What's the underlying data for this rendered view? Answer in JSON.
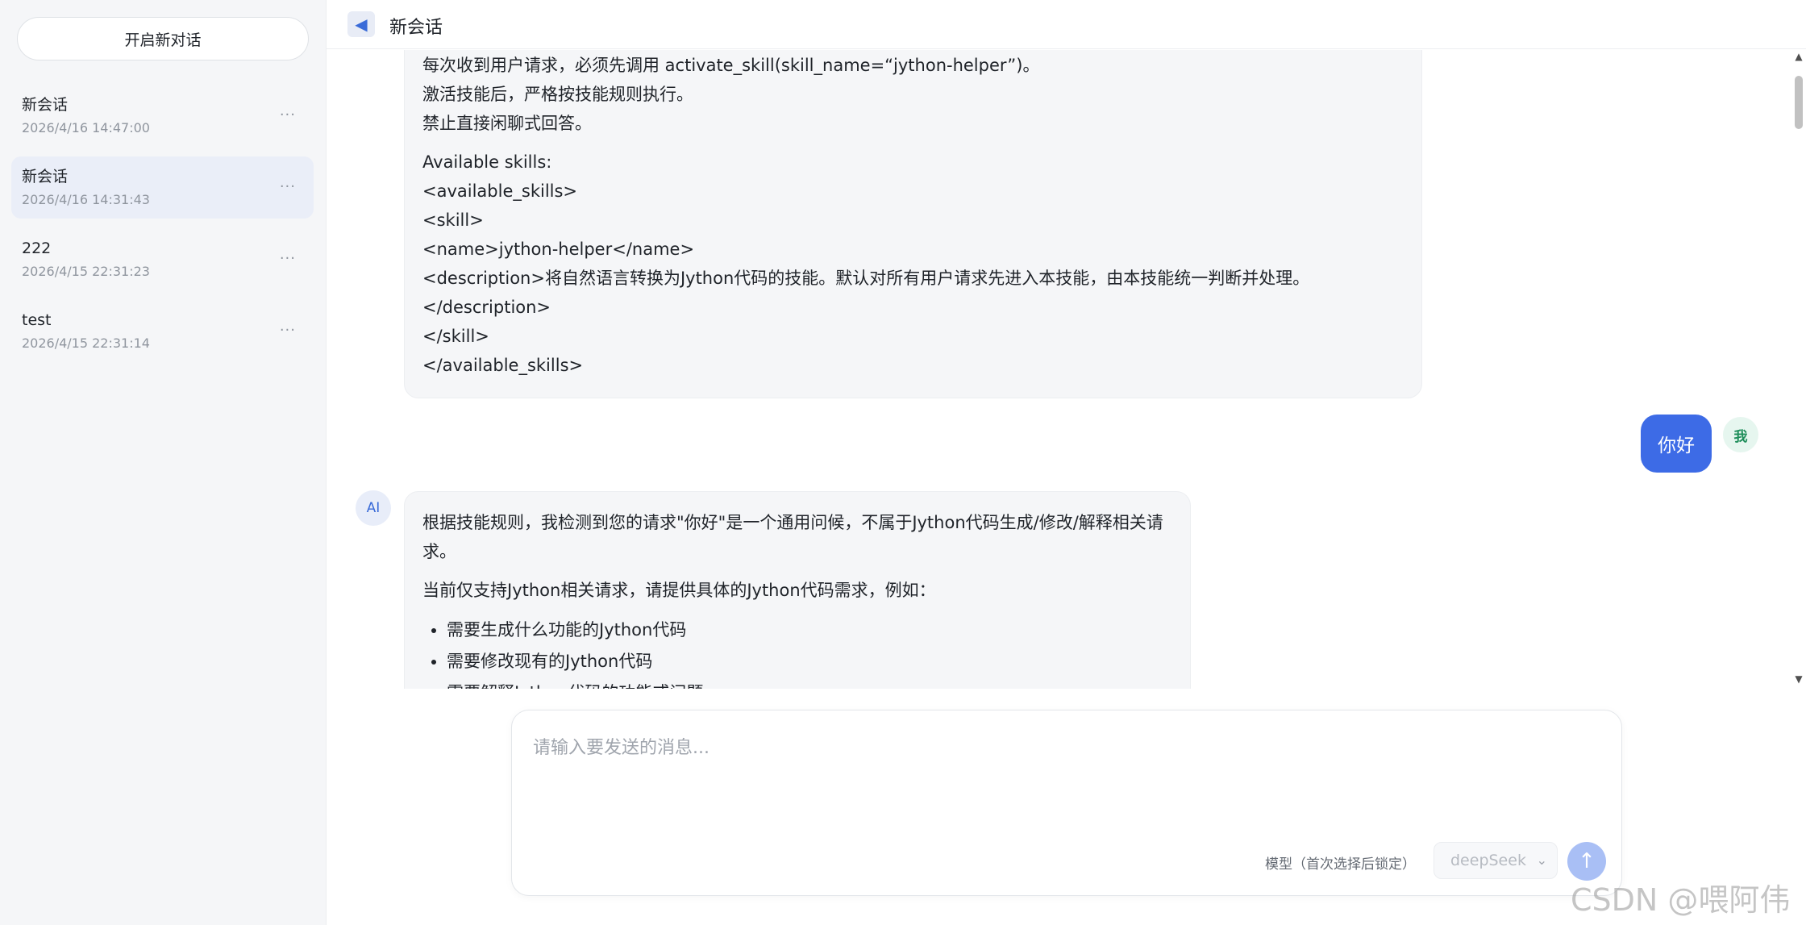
{
  "sidebar": {
    "new_chat_label": "开启新对话",
    "sessions": [
      {
        "title": "新会话",
        "time": "2026/4/16 14:47:00",
        "more": "..."
      },
      {
        "title": "新会话",
        "time": "2026/4/16 14:31:43",
        "more": "..."
      },
      {
        "title": "222",
        "time": "2026/4/15 22:31:23",
        "more": "..."
      },
      {
        "title": "test",
        "time": "2026/4/15 22:31:14",
        "more": "..."
      }
    ],
    "active_index": 1
  },
  "header": {
    "back_icon": "◀",
    "title": "新会话"
  },
  "chat": {
    "system_message": {
      "lines_a": [
        "每次收到用户请求，必须先调用 activate_skill(skill_name=“jython-helper”)。",
        "激活技能后，严格按技能规则执行。",
        "禁止直接闲聊式回答。"
      ],
      "lines_b": [
        "Available skills:",
        "<available_skills>",
        "<skill>",
        "<name>jython-helper</name>",
        "<description>将自然语言转换为Jython代码的技能。默认对所有用户请求先进入本技能，由本技能统一判断并处理。",
        "</description>",
        "</skill>",
        "</available_skills>"
      ]
    },
    "user_message": {
      "text": "你好",
      "avatar": "我"
    },
    "ai_message": {
      "avatar": "AI",
      "para1": "根据技能规则，我检测到您的请求\"你好\"是一个通用问候，不属于Jython代码生成/修改/解释相关请求。",
      "para2": "当前仅支持Jython相关请求，请提供具体的Jython代码需求，例如：",
      "bullets": [
        "需要生成什么功能的Jython代码",
        "需要修改现有的Jython代码",
        "需要解释Jython代码的功能或问题"
      ]
    }
  },
  "input": {
    "placeholder": "请输入要发送的消息...",
    "model_label": "模型（首次选择后锁定）",
    "model_value": "deepSeek",
    "send_icon": "↑"
  },
  "watermark": "CSDN @喂阿伟",
  "colors": {
    "accent": "#3d6be6",
    "send_disabled": "#a9bff5",
    "sidebar_bg": "#f5f6f8",
    "active_item_bg": "#eaeef8"
  }
}
